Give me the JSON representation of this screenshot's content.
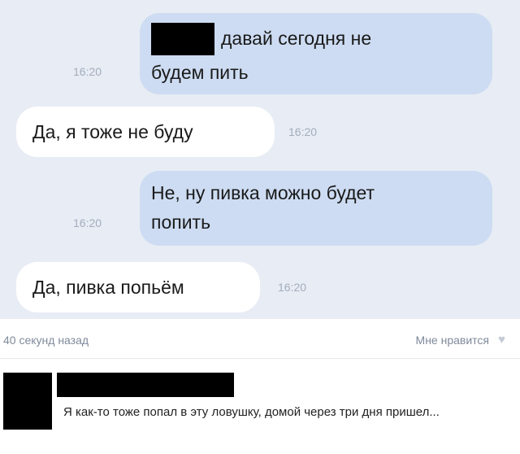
{
  "messages": [
    {
      "direction": "out",
      "line1": "давай сегодня не",
      "line2": "будем пить",
      "time": "16:20",
      "redacted_prefix": true
    },
    {
      "direction": "in",
      "text": "Да, я тоже не буду",
      "time": "16:20"
    },
    {
      "direction": "out",
      "line1": "Не, ну пивка можно будет",
      "line2": "попить",
      "time": "16:20"
    },
    {
      "direction": "in",
      "text": "Да, пивка попьём",
      "time": "16:20"
    }
  ],
  "post_meta": {
    "time_ago": "40 секунд назад",
    "like_label": "Мне нравится",
    "like_icon": "heart-icon"
  },
  "comment": {
    "text": "Я как-то тоже попал в эту ловушку, домой через три дня пришел..."
  },
  "colors": {
    "chat_background": "#e8ecf4",
    "outgoing_bubble": "#cddcf2",
    "incoming_bubble": "#ffffff",
    "timestamp": "#a3adbd"
  }
}
